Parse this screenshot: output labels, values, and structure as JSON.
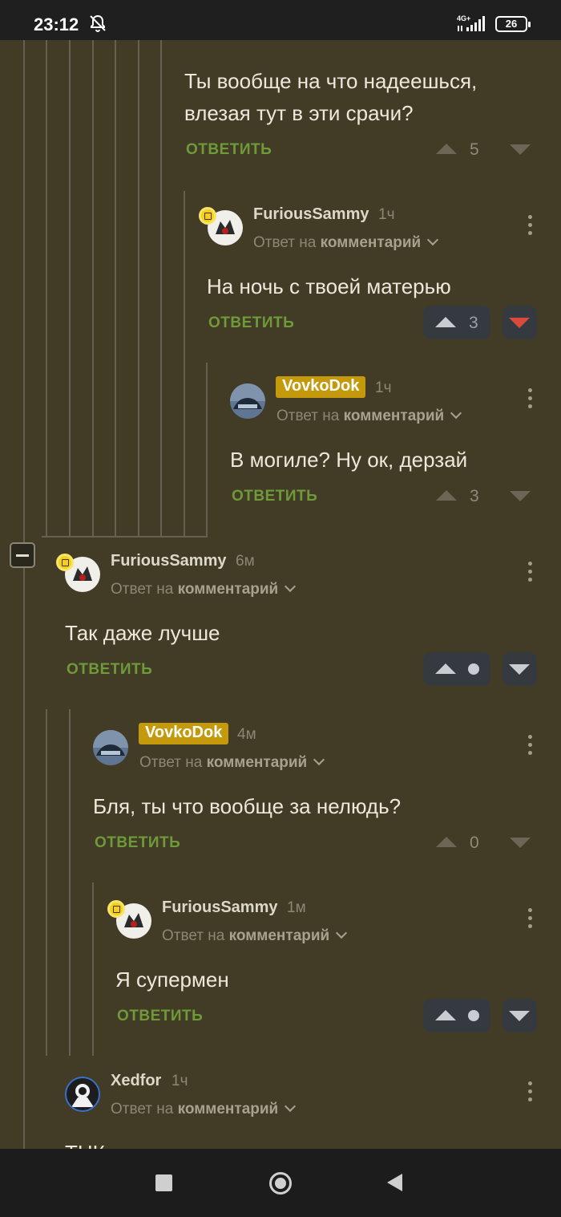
{
  "status_bar": {
    "time": "23:12",
    "network": "4G+",
    "battery": "26"
  },
  "labels": {
    "reply_to": "Ответ на",
    "comment": "комментарий",
    "reply_button": "ОТВЕТИТЬ"
  },
  "thread": [
    {
      "author": "",
      "time": "",
      "text": "Ты вообще на что надеешься,",
      "text2": "влезая тут в эти срачи?",
      "score": "5"
    },
    {
      "author": "FuriousSammy",
      "time": "1ч",
      "text": "На ночь с твоей матерью",
      "score": "3",
      "vote": "down"
    },
    {
      "author": "VovkoDok",
      "time": "1ч",
      "text": "В могиле? Ну ок, дерзай",
      "score": "3"
    },
    {
      "author": "FuriousSammy",
      "time": "6м",
      "text": "Так даже лучше",
      "score": ""
    },
    {
      "author": "VovkoDok",
      "time": "4м",
      "text": "Бля, ты что вообще за нелюдь?",
      "score": "0"
    },
    {
      "author": "FuriousSammy",
      "time": "1м",
      "text": "Я супермен",
      "score": ""
    },
    {
      "author": "Xedfor",
      "time": "1ч",
      "text": "ТНК уже поднимается и нему не стоит"
    }
  ],
  "icons": {
    "dnd": "bell-off-icon",
    "collapse": "minus-icon",
    "more": "more-vertical-icon",
    "up": "upvote-icon",
    "down": "downvote-icon"
  }
}
